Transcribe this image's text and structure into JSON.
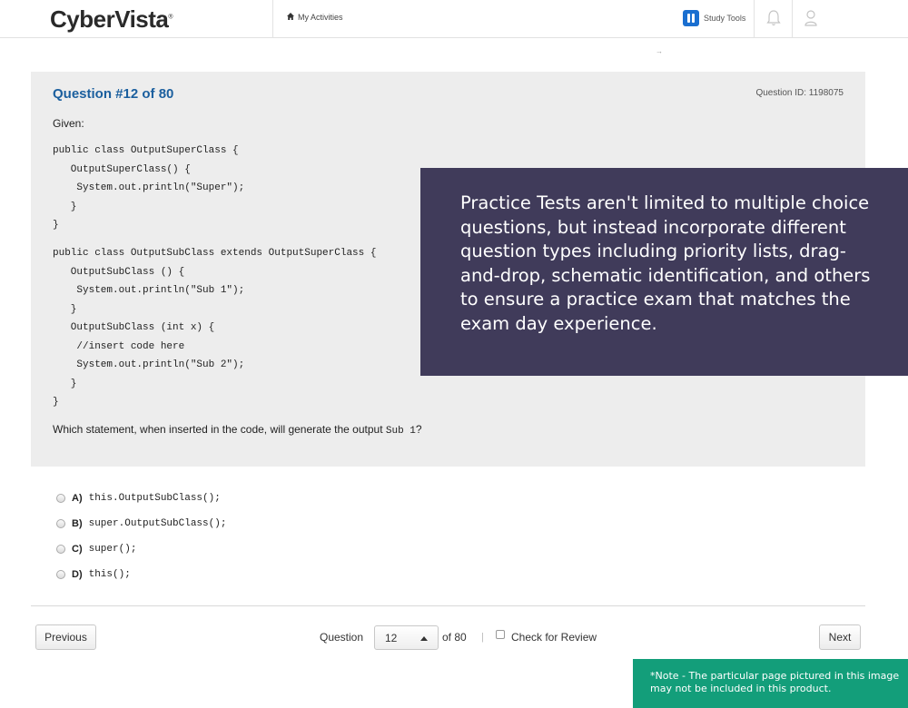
{
  "header": {
    "logo_text": "CyberVista",
    "logo_mark": "®",
    "nav_activities": "My Activities",
    "study_tools": "Study Tools",
    "icons": [
      "home-icon",
      "study-tools-icon",
      "bell-icon",
      "user-icon"
    ]
  },
  "misc": {
    "arrow": "→"
  },
  "question": {
    "title": "Question #12 of 80",
    "id_label": "Question ID: 1198075",
    "given": "Given:",
    "code_block_1": "public class OutputSuperClass {\n   OutputSuperClass() {\n    System.out.println(\"Super\");\n   }\n}",
    "code_block_2": "public class OutputSubClass extends OutputSuperClass {\n   OutputSubClass () {\n    System.out.println(\"Sub 1\");\n   }\n   OutputSubClass (int x) {\n    //insert code here\n    System.out.println(\"Sub 2\");\n   }\n}",
    "prompt_prefix": "Which statement, when inserted in the code, will generate the output ",
    "prompt_code": "Sub 1",
    "prompt_suffix": "?"
  },
  "callout": {
    "text": "Practice Tests aren't limited to multiple choice questions, but instead incorporate different question types including priority lists, drag-and-drop, schematic identification, and others to ensure a practice exam that matches the exam day experience."
  },
  "answers": [
    {
      "letter": "A)",
      "text": "this.OutputSubClass();"
    },
    {
      "letter": "B)",
      "text": "super.OutputSubClass();"
    },
    {
      "letter": "C)",
      "text": "super();"
    },
    {
      "letter": "D)",
      "text": "this();"
    }
  ],
  "footer": {
    "previous": "Previous",
    "question_label": "Question",
    "current": "12",
    "of_total": "of 80",
    "separator": "|",
    "check_for_review": "Check for Review",
    "next": "Next"
  },
  "note": "*Note - The particular page pictured in this image may not be included in this product."
}
